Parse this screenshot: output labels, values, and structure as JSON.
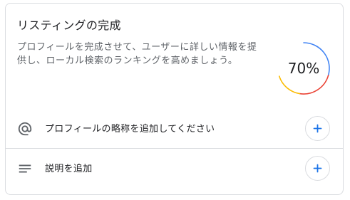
{
  "card": {
    "title": "リスティングの完成",
    "description": "プロフィールを完成させて、ユーザーに詳しい情報を提供し、ローカル検索のランキングを高めましょう。"
  },
  "progress": {
    "value": 70,
    "label": "70%",
    "colors": {
      "blue": "#4285f4",
      "red": "#ea4335",
      "orange": "#fbbc04",
      "track": "#ffffff"
    }
  },
  "tasks": [
    {
      "icon": "at-sign-icon",
      "label": "プロフィールの略称を追加してください"
    },
    {
      "icon": "notes-lines-icon",
      "label": "説明を追加"
    }
  ],
  "colors": {
    "accent": "#1a73e8",
    "divider": "#dadce0",
    "text_primary": "#202124",
    "text_secondary": "#5f6368"
  }
}
